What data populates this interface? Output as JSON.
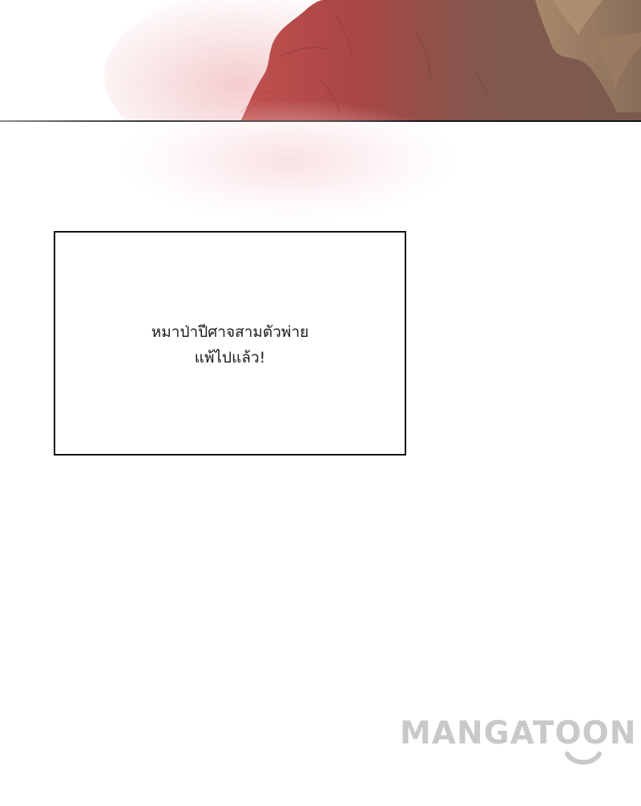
{
  "caption": {
    "lines": [
      "หมาป่าปีศาจสามตัวพ่าย",
      "แพ้ไปแล้ว!"
    ]
  },
  "watermark": {
    "text": "MANGATOON"
  },
  "colors": {
    "hair_red": "#b84a4a",
    "hair_brown": "#7d5a50",
    "light_brown": "#a88a6a",
    "panel_border": "#111111",
    "watermark": "#c9c9c9"
  }
}
